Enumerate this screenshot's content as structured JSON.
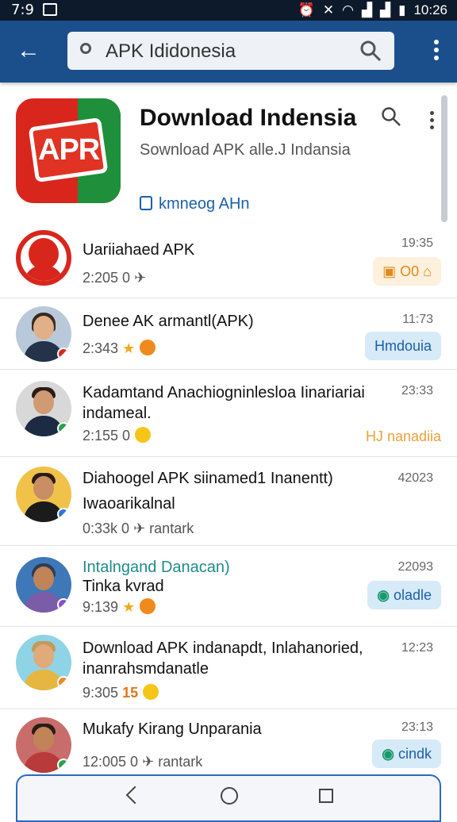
{
  "status_bar": {
    "time": "7:9",
    "clock": "10:26"
  },
  "search": {
    "value": "APK Ididonesia"
  },
  "header": {
    "logo_text": "APR",
    "title": "Download Indensia",
    "subtitle": "Sownload APK alle.J Indansia",
    "link": "kmneog AHn"
  },
  "rows": [
    {
      "title": "Uariiahaed APK",
      "line2": "",
      "meta": "2:205 0",
      "time": "19:35",
      "badge": "O0",
      "badge_style": "orange"
    },
    {
      "title": "Denee AK armantl(APK)",
      "line2": "",
      "meta": "2:343",
      "time": "11:73",
      "badge": "Hmdouia",
      "badge_style": "blue"
    },
    {
      "title": "Kadamtand Anachiogninlesloa Iinariariai",
      "line2": "indameal.",
      "meta": "2:155 0",
      "time": "23:33",
      "badge": "HJ nanadiia",
      "badge_style": "orange-text"
    },
    {
      "title": "Diahoogel APK siinamed1 Inanentt)",
      "line2": "Iwaoarikalnal",
      "meta": "0:33k 0",
      "meta_extra": "rantark",
      "time": "42023",
      "badge": "",
      "badge_style": "none"
    },
    {
      "title": "Intalngand Danacan)",
      "line2": "Tinka kvrad",
      "meta": "9:139",
      "time": "22093",
      "badge": "oladle",
      "badge_style": "blue-icon"
    },
    {
      "title": "Download APK indanapdt, Inlahanoried,",
      "line2": "inanrahsmdanatle",
      "meta": "9:305",
      "meta_num": "15",
      "time": "12:23",
      "badge": "",
      "badge_style": "none"
    },
    {
      "title": "Mukafy Kirang Unparania",
      "line2": "",
      "meta": "12:005 0",
      "meta_extra": "rantark",
      "time": "23:13",
      "badge": "cindk",
      "badge_style": "blue-icon"
    }
  ],
  "colors": {
    "appbar": "#1b4f8c",
    "accent": "#1b5fa8",
    "badge_blue": "#d7eaf8",
    "badge_orange": "#fdf0dc"
  }
}
